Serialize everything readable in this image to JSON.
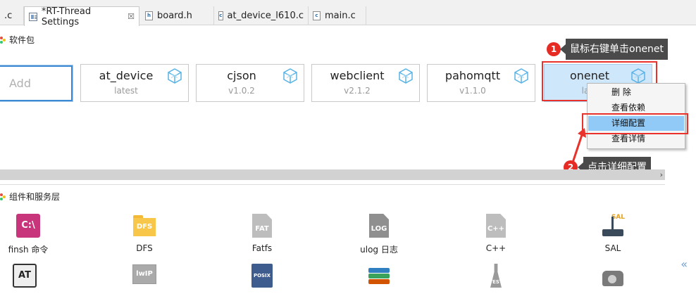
{
  "tabs": [
    {
      "label": ".c"
    },
    {
      "label": "*RT-Thread Settings",
      "close": "☒"
    },
    {
      "label": "board.h"
    },
    {
      "label": "at_device_l610.c"
    },
    {
      "label": "main.c"
    }
  ],
  "packages_section": {
    "title": "软件包"
  },
  "add_input": {
    "placeholder": "Add"
  },
  "packages": [
    {
      "name": "at_device",
      "version": "latest"
    },
    {
      "name": "cjson",
      "version": "v1.0.2"
    },
    {
      "name": "webclient",
      "version": "v2.1.2"
    },
    {
      "name": "pahomqtt",
      "version": "v1.1.0"
    },
    {
      "name": "onenet",
      "version": "late"
    }
  ],
  "context_menu": {
    "items": [
      {
        "label": "删 除"
      },
      {
        "label": "查看依赖"
      },
      {
        "label": "详细配置"
      },
      {
        "label": "查看详情"
      }
    ]
  },
  "annotations": {
    "step1": {
      "num": "1",
      "text": "鼠标右键单击onenet"
    },
    "step2": {
      "num": "2",
      "text": "点击详细配置"
    }
  },
  "components_section": {
    "title": "组件和服务层"
  },
  "components": [
    {
      "label": "finsh 命令",
      "icon": "finsh-icon",
      "glyph": "C:\\"
    },
    {
      "label": "DFS",
      "icon": "dfs-folder-icon"
    },
    {
      "label": "Fatfs",
      "icon": "fatfs-document-icon",
      "glyph": "FAT"
    },
    {
      "label": "ulog 日志",
      "icon": "ulog-document-icon",
      "glyph": "LOG"
    },
    {
      "label": "C++",
      "icon": "cpp-document-icon",
      "glyph": "C++"
    },
    {
      "label": "SAL",
      "icon": "sal-router-icon"
    },
    {
      "icon": "at-client-icon",
      "glyph": "AT"
    },
    {
      "icon": "lwip-icon",
      "glyph": "lwIP"
    },
    {
      "icon": "posix-icon",
      "glyph": "POSIX"
    },
    {
      "icon": "libc-books-icon"
    },
    {
      "icon": "test-flask-icon"
    },
    {
      "icon": "telephone-icon"
    }
  ],
  "colors": {
    "selected_card": "#cfe7fb",
    "menu_highlight": "#91c9f7",
    "annotation_red": "#e8322b",
    "callout_bg": "#4a4a4a"
  }
}
